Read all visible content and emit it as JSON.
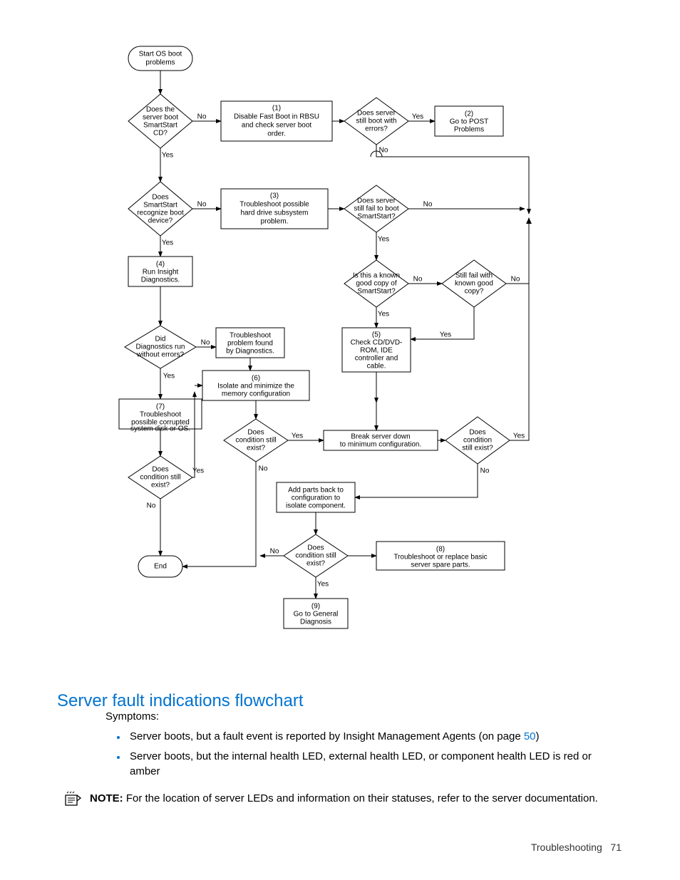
{
  "flowchart": {
    "terminators": {
      "start": "Start OS boot\nproblems",
      "end": "End"
    },
    "decisions": {
      "d_boot_cd": "Does the\nserver boot\nSmartStart\nCD?",
      "d_still_boot_errors": "Does server\nstill boot with\nerrors?",
      "d_recognize_boot": "Does\nSmartStart\nrecognize boot\ndevice?",
      "d_still_fail_ss": "Does server\nstill fail to boot\nSmartStart?",
      "d_known_copy": "Is this a known\ngood copy of\nSmartStart?",
      "d_still_fail_known": "Still fail with\nknown good\ncopy?",
      "d_diag_errors": "Did\nDiagnostics run\nwithout errors?",
      "d_cond1": "Does\ncondition still\nexist?",
      "d_cond_left": "Does\ncondition still\nexist?",
      "d_cond_right": "Does\ncondition\nstill exist?",
      "d_cond2": "Does\ncondition still\nexist?"
    },
    "processes": {
      "p1": "(1)\nDisable Fast Boot in RBSU\nand check server boot\norder.",
      "p2": "(2)\nGo to POST\nProblems",
      "p3": "(3)\nTroubleshoot possible\nhard drive subsystem\nproblem.",
      "p4": "(4)\nRun Insight\nDiagnostics.",
      "p5": "(5)\nCheck CD/DVD-\nROM, IDE\ncontroller and\ncable.",
      "p6": "(6)\nIsolate and minimize the\nmemory configuration",
      "p7": "(7)\nTroubleshoot\npossible corrupted\nsystem disk or OS.",
      "p8": "(8)\nTroubleshoot or replace basic\nserver spare parts.",
      "p9": "(9)\nGo to General\nDiagnosis",
      "p_diag_trouble": "Troubleshoot\nproblem found\nby Diagnostics.",
      "p_break": "Break server down\nto minimum configuration.",
      "p_addparts": "Add parts back to\nconfiguration to\nisolate component."
    },
    "labels": {
      "yes": "Yes",
      "no": "No"
    }
  },
  "heading": "Server fault indications flowchart",
  "body": {
    "symptoms_label": "Symptoms:",
    "bullet1_pre": "Server boots, but a fault event is reported by Insight Management Agents (on page ",
    "bullet1_link": "50",
    "bullet1_post": ")",
    "bullet2": "Server boots, but the internal health LED, external health LED, or component health LED is red or amber"
  },
  "note": {
    "label": "NOTE:",
    "text": "For the location of server LEDs and information on their statuses, refer to the server documentation."
  },
  "footer": {
    "section": "Troubleshooting",
    "page": "71"
  }
}
